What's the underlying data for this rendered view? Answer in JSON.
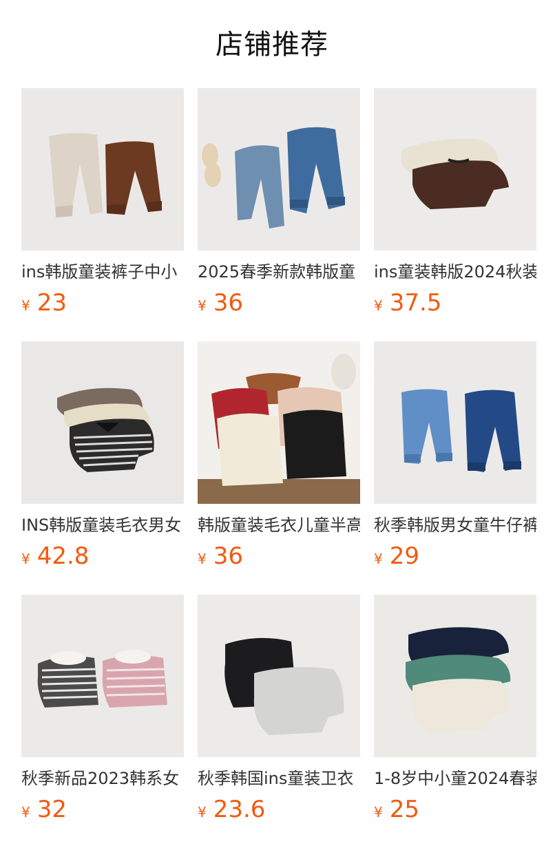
{
  "section": {
    "title": "店铺推荐"
  },
  "currency_symbol": "¥",
  "products": [
    {
      "title": "ins韩版童装裤子中小",
      "price": "23"
    },
    {
      "title": "2025春季新款韩版童",
      "price": "36"
    },
    {
      "title": "ins童装韩版2024秋装",
      "price": "37.5"
    },
    {
      "title": "INS韩版童装毛衣男女",
      "price": "42.8"
    },
    {
      "title": "韩版童装毛衣儿童半高",
      "price": "36"
    },
    {
      "title": "秋季韩版男女童牛仔裤",
      "price": "29"
    },
    {
      "title": "秋季新品2023韩系女",
      "price": "32"
    },
    {
      "title": "秋季韩国ins童装卫衣",
      "price": "23.6"
    },
    {
      "title": "1-8岁中小童2024春装",
      "price": "25"
    }
  ],
  "colors": {
    "price": "#f15a0f",
    "title": "#333333",
    "heading": "#111111"
  }
}
